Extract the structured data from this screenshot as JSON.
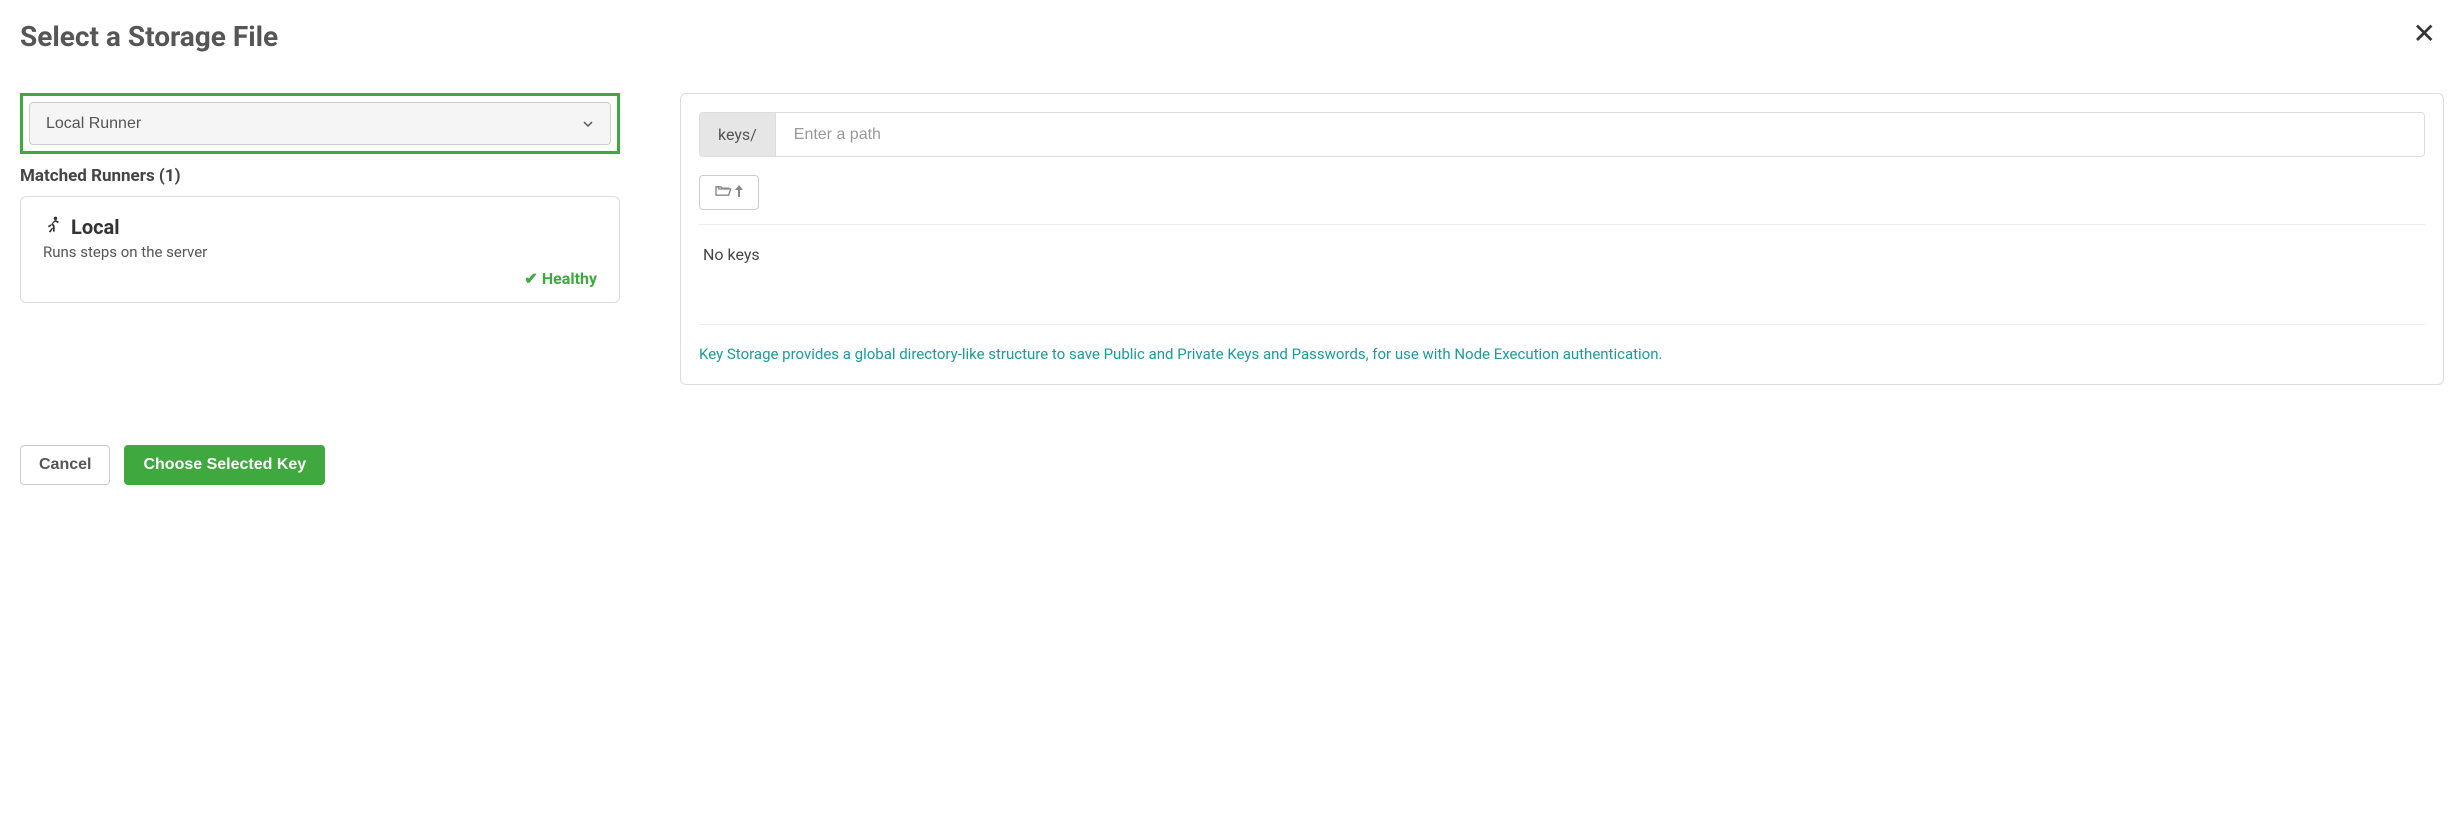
{
  "header": {
    "title": "Select a Storage File"
  },
  "left": {
    "dropdown_selected": "Local Runner",
    "matched_label": "Matched Runners (1)",
    "runner": {
      "name": "Local",
      "description": "Runs steps on the server",
      "status": "Healthy"
    }
  },
  "right": {
    "path_prefix": "keys/",
    "path_placeholder": "Enter a path",
    "no_keys": "No keys",
    "help_text": "Key Storage provides a global directory-like structure to save Public and Private Keys and Passwords, for use with Node Execution authentication."
  },
  "footer": {
    "cancel": "Cancel",
    "choose": "Choose Selected Key"
  }
}
